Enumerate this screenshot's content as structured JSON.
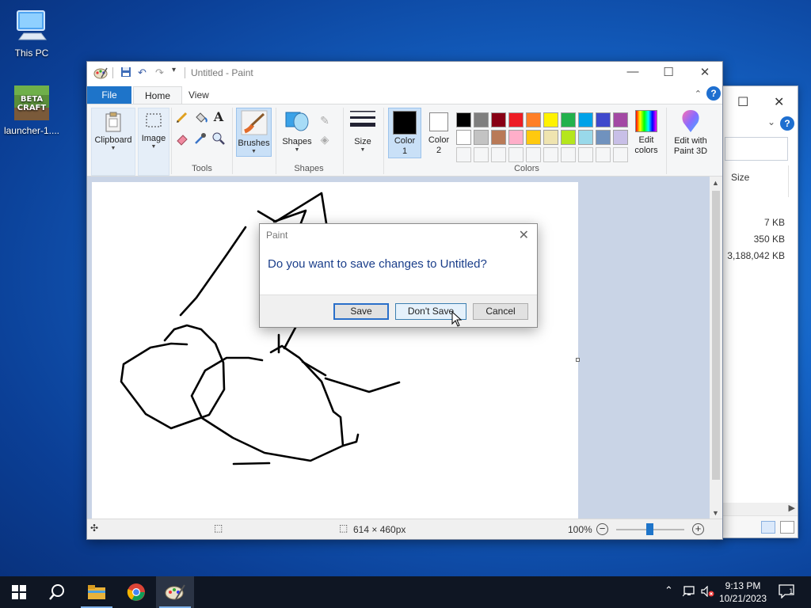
{
  "desktop": {
    "icons": [
      {
        "label": "This PC",
        "icon": "computer-icon"
      },
      {
        "label": "launcher-1....",
        "icon": "betacraft-launcher-icon",
        "logo_text": "BETA CRAFT"
      }
    ]
  },
  "explorer": {
    "column_size": "Size",
    "sizes": [
      "7 KB",
      "350 KB",
      "3,188,042 KB"
    ],
    "help_label": "?"
  },
  "paint": {
    "title": "Untitled - Paint",
    "tabs": {
      "file": "File",
      "home": "Home",
      "view": "View"
    },
    "help_label": "?",
    "ribbon": {
      "clipboard": "Clipboard",
      "image": "Image",
      "tools_group": "Tools",
      "brushes": "Brushes",
      "shapes": "Shapes",
      "shapes_group": "Shapes",
      "size": "Size",
      "color1_line1": "Color",
      "color1_line2": "1",
      "color2_line1": "Color",
      "color2_line2": "2",
      "colors_group": "Colors",
      "edit_colors_line1": "Edit",
      "edit_colors_line2": "colors",
      "paint3d_line1": "Edit with",
      "paint3d_line2": "Paint 3D"
    },
    "palette_row1": [
      "#000000",
      "#7f7f7f",
      "#880015",
      "#ed1c24",
      "#ff7f27",
      "#fff200",
      "#22b14c",
      "#00a2e8",
      "#3f48cc",
      "#a349a4"
    ],
    "palette_row2": [
      "#ffffff",
      "#c3c3c3",
      "#b97a57",
      "#ffaec9",
      "#ffc90e",
      "#efe4b0",
      "#b5e61d",
      "#99d9ea",
      "#7092be",
      "#c8bfe7"
    ],
    "color1": "#000000",
    "color2": "#ffffff",
    "status": {
      "dimensions": "614 × 460px",
      "zoom": "100%",
      "zoom_minus": "−",
      "zoom_plus": "+"
    }
  },
  "dialog": {
    "title": "Paint",
    "message": "Do you want to save changes to Untitled?",
    "save": "Save",
    "dont_save": "Don't Save",
    "cancel": "Cancel"
  },
  "taskbar": {
    "items": [
      "start-icon",
      "search-icon",
      "file-explorer-icon",
      "chrome-icon",
      "paint-icon"
    ],
    "time": "9:13 PM",
    "date": "10/21/2023",
    "notifications": "1"
  }
}
